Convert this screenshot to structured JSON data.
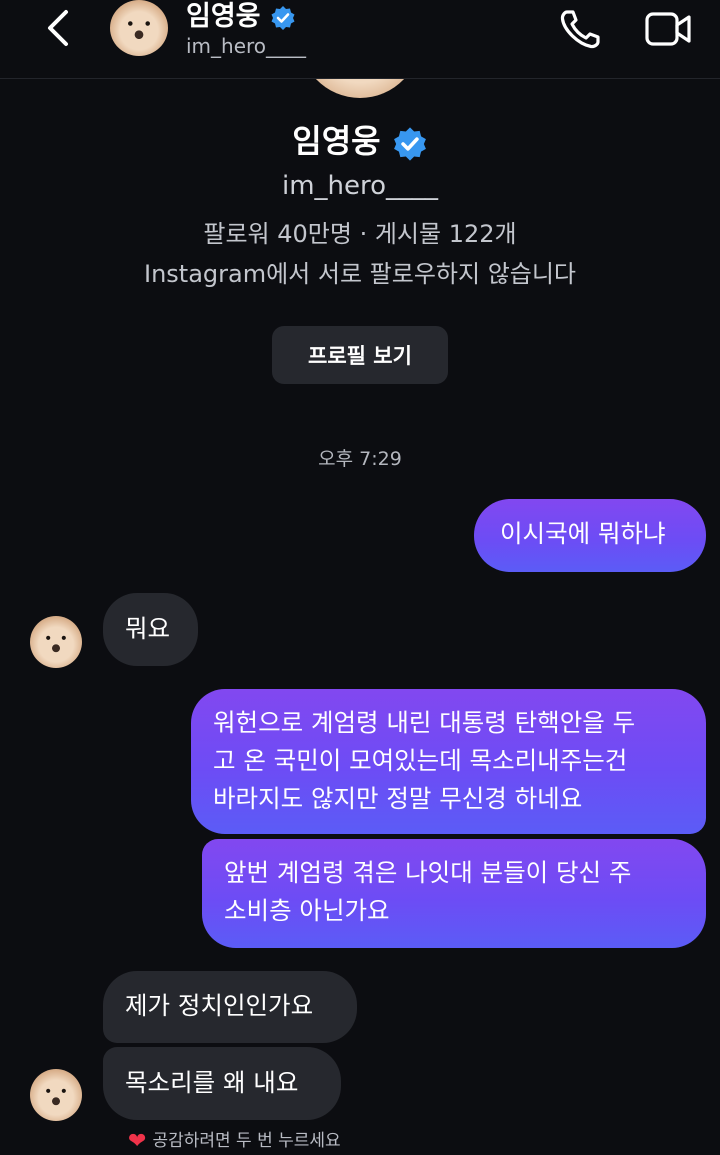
{
  "header": {
    "name": "임영웅",
    "username": "im_hero____",
    "icons": [
      "back-chevron-icon",
      "verified-badge-icon",
      "phone-icon",
      "video-call-icon"
    ]
  },
  "profile": {
    "name": "임영웅",
    "username": "im_hero____",
    "stats": "팔로워 40만명 · 게시물 122개",
    "follow_status": "Instagram에서 서로 팔로우하지 않습니다",
    "view_profile_label": "프로필 보기"
  },
  "timestamp": "오후 7:29",
  "messages": [
    {
      "from": "me",
      "text": "이시국에 뭐하냐"
    },
    {
      "from": "them",
      "text": "뭐요"
    },
    {
      "from": "me",
      "lines": [
        "워헌으로 계엄령 내린 대통령 탄핵안을 두",
        "고 온 국민이 모여있는데 목소리내주는건",
        "바라지도 않지만 정말 무신경 하네요"
      ]
    },
    {
      "from": "me",
      "lines": [
        "앞번 계엄령 겪은 나잇대 분들이 당신 주",
        "소비층 아닌가요"
      ]
    },
    {
      "from": "them",
      "text": "제가 정치인인가요"
    },
    {
      "from": "them",
      "text": "목소리를 왜 내요"
    }
  ],
  "reaction_hint": "공감하려면 두 번 누르세요",
  "colors": {
    "background": "#0c0d11",
    "incoming_bubble": "#26282e",
    "outgoing_bubble_top": "#8248f0",
    "outgoing_bubble_bottom": "#5b5cf6",
    "verified": "#3897f0",
    "heart": "#f0334a"
  }
}
